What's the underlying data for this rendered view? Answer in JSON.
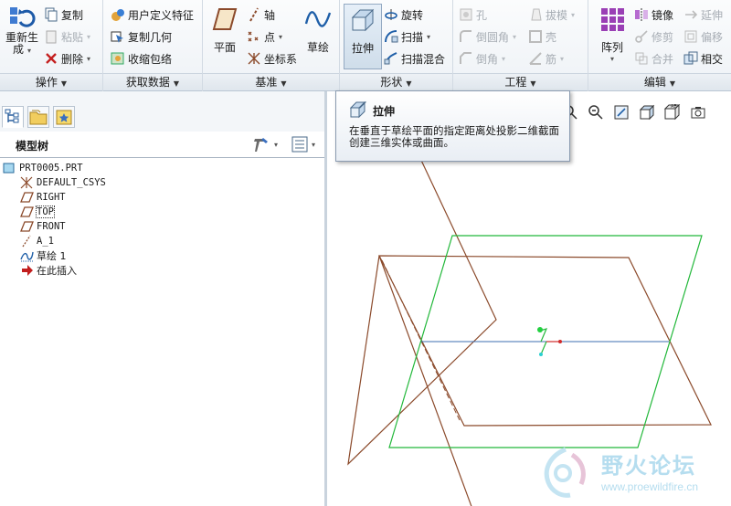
{
  "ribbon": {
    "groups": {
      "operations": {
        "label": "操作",
        "regenerate": "重新生\n成",
        "copy": "复制",
        "paste": "粘贴",
        "delete": "删除"
      },
      "getdata": {
        "label": "获取数据",
        "udf": "用户定义特征",
        "copy_geom": "复制几何",
        "shrinkwrap": "收缩包络"
      },
      "datum": {
        "label": "基准",
        "plane": "平面",
        "axis": "轴",
        "point": "点",
        "csys": "坐标系",
        "sketch": "草绘"
      },
      "shapes": {
        "label": "形状",
        "extrude": "拉伸",
        "revolve": "旋转",
        "sweep": "扫描",
        "swept_blend": "扫描混合"
      },
      "engineering": {
        "label": "工程",
        "hole": "孔",
        "round": "倒圆角",
        "chamfer": "倒角",
        "draft": "拔模",
        "shell": "壳",
        "rib": "筋"
      },
      "editing": {
        "label": "编辑",
        "pattern": "阵列",
        "mirror": "镜像",
        "trim": "修剪",
        "merge": "合并",
        "extend": "延伸",
        "offset": "偏移",
        "intersect": "相交"
      }
    }
  },
  "model_tree": {
    "title": "模型树",
    "nodes": [
      "PRT0005.PRT",
      "DEFAULT_CSYS",
      "RIGHT",
      "TOP",
      "FRONT",
      "A_1",
      "草绘 1",
      "在此插入"
    ]
  },
  "tooltip": {
    "title": "拉伸",
    "description": "在垂直于草绘平面的指定距离处投影二维截面创建三维实体或曲面。"
  },
  "watermark": {
    "text": "野火论坛",
    "url": "www.proewildfire.cn"
  },
  "colors": {
    "datum_brown": "#8b4a2b",
    "datum_green": "#22b83a",
    "accent": "#1f5fa8"
  }
}
